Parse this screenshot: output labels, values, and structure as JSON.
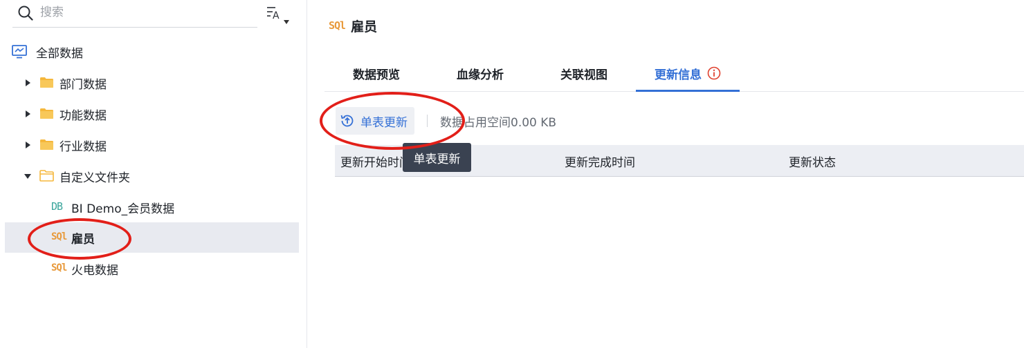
{
  "sidebar": {
    "search_placeholder": "搜索",
    "root": {
      "label": "全部数据"
    },
    "items": [
      {
        "label": "部门数据",
        "type": "folder",
        "expanded": false
      },
      {
        "label": "功能数据",
        "type": "folder",
        "expanded": false
      },
      {
        "label": "行业数据",
        "type": "folder",
        "expanded": false
      },
      {
        "label": "自定义文件夹",
        "type": "folder",
        "expanded": true
      },
      {
        "label": "BI Demo_会员数据",
        "type": "db",
        "icon_text": "DB"
      },
      {
        "label": "雇员",
        "type": "sql",
        "icon_text": "SQl",
        "selected": true
      },
      {
        "label": "火电数据",
        "type": "sql",
        "icon_text": "SQl"
      }
    ]
  },
  "main": {
    "title": "雇员",
    "title_icon_text": "SQl",
    "tabs": [
      {
        "label": "数据预览"
      },
      {
        "label": "血缘分析"
      },
      {
        "label": "关联视图"
      },
      {
        "label": "更新信息",
        "active": true
      }
    ],
    "toolbar": {
      "refresh_label": "单表更新",
      "storage_text": "数据占用空间0.00 KB"
    },
    "table": {
      "columns": [
        "更新开始时间",
        "更新完成时间",
        "更新状态"
      ]
    },
    "tooltip": "单表更新"
  },
  "colors": {
    "accent": "#3470d6",
    "sql_icon": "#e89a3c",
    "db_icon": "#3aa59b",
    "folder": "#f5b73b",
    "annotation": "#e21f19",
    "info": "#e0412f"
  }
}
